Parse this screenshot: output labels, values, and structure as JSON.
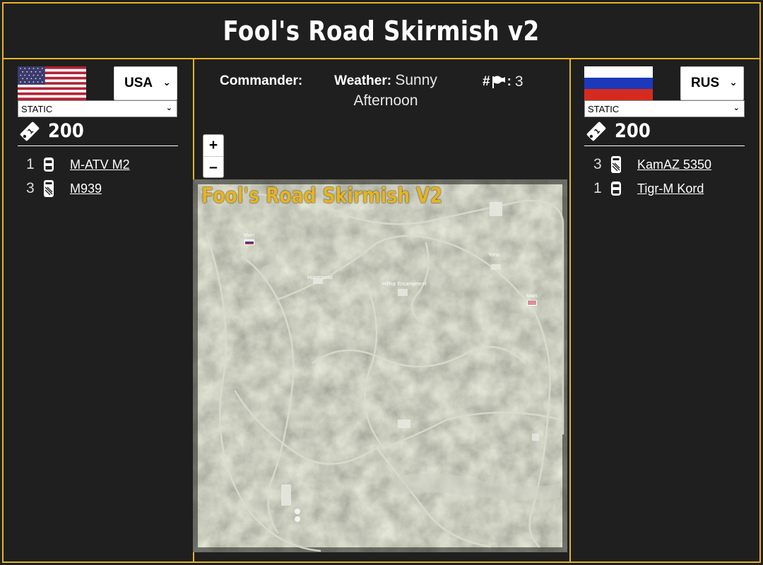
{
  "page_title": "Fool's Road Skirmish v2",
  "colors": {
    "accent": "#e6b422",
    "background": "#1f1f1f"
  },
  "left": {
    "faction": "USA",
    "mode": "STATIC",
    "tickets": "200",
    "units": [
      {
        "count": "1",
        "name": "M-ATV M2",
        "icon": "car-icon"
      },
      {
        "count": "3",
        "name": "M939",
        "icon": "truck-icon"
      }
    ]
  },
  "right": {
    "faction": "RUS",
    "mode": "STATIC",
    "tickets": "200",
    "units": [
      {
        "count": "3",
        "name": "KamAZ 5350",
        "icon": "truck-icon"
      },
      {
        "count": "1",
        "name": "Tigr-M Kord",
        "icon": "car-icon"
      }
    ]
  },
  "info": {
    "commander_label": "Commander:",
    "weather_label": "Weather:",
    "weather_value": "Sunny Afternoon",
    "flags_hash": "#",
    "flags_colon": ":",
    "flags_value": "3"
  },
  "zoom": {
    "in": "+",
    "out": "–"
  },
  "map": {
    "title": "Fool's Road Skirmish V2",
    "main_base_label": "Main",
    "towns": [
      "Homestead",
      "Hilltop Encampment",
      "Yorto"
    ]
  }
}
